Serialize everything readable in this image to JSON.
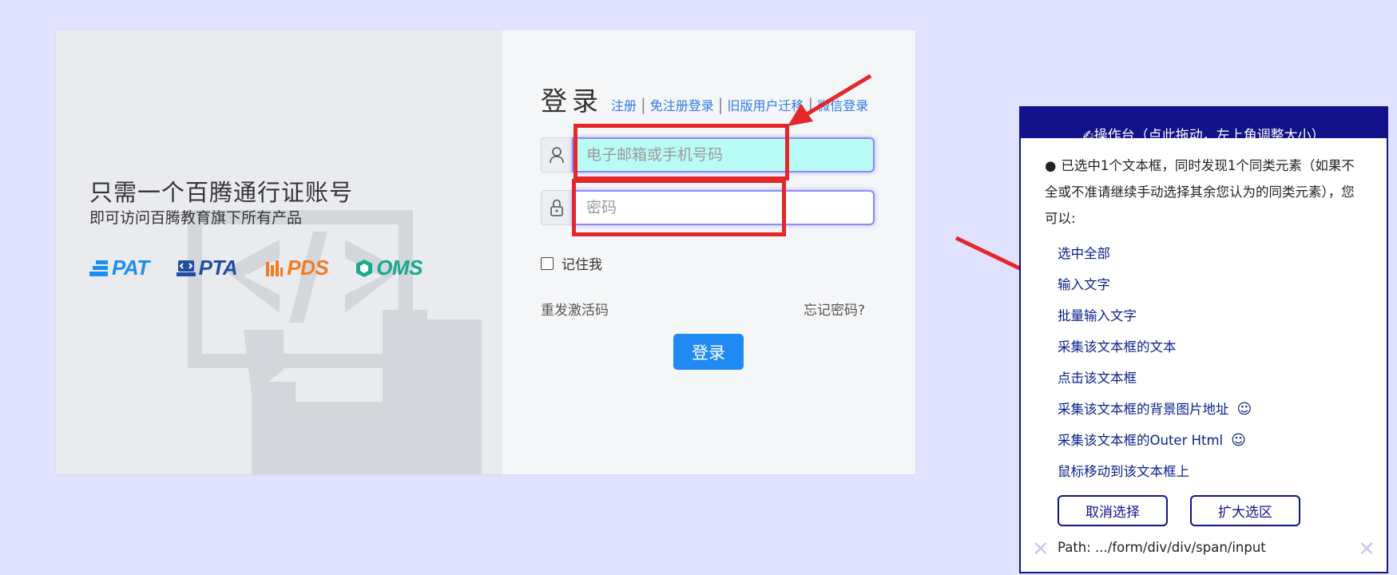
{
  "left": {
    "slogan_main": "只需一个百腾通行证账号",
    "slogan_sub": "即可访问百腾教育旗下所有产品",
    "brands": [
      {
        "label": "PAT",
        "color": "#1b8ef0",
        "icon": "pat-icon"
      },
      {
        "label": "PTA",
        "color": "#1f4fa3",
        "icon": "pta-icon"
      },
      {
        "label": "PDS",
        "color": "#f47a20",
        "icon": "pds-icon"
      },
      {
        "label": "OMS",
        "color": "#17a98f",
        "icon": "oms-icon"
      }
    ]
  },
  "login": {
    "title": "登录",
    "links": [
      "注册",
      "免注册登录",
      "旧版用户迁移",
      "微信登录"
    ],
    "username_placeholder": "电子邮箱或手机号码",
    "password_placeholder": "密码",
    "remember_label": "记住我",
    "resend_label": "重发激活码",
    "forgot_label": "忘记密码?",
    "submit_label": "登录"
  },
  "panel": {
    "header": "✍操作台（点此拖动，左上角调整大小）",
    "bullet": "●",
    "message": "已选中1个文本框，同时发现1个同类元素（如果不全或不准请继续手动选择其余您认为的同类元素），您可以:",
    "options": [
      "选中全部",
      "输入文字",
      "批量输入文字",
      "采集该文本框的文本",
      "点击该文本框",
      "采集该文本框的背景图片地址",
      "采集该文本框的Outer Html",
      "鼠标移动到该文本框上"
    ],
    "smile_glyph": "☺",
    "cancel_label": "取消选择",
    "expand_label": "扩大选区",
    "path": "Path: .../form/div/div/span/input",
    "close_glyph": "✕"
  },
  "colors": {
    "accent": "#1f8af3",
    "panel_navy": "#12128a",
    "annotation_red": "#e5262b",
    "highlight_cyan": "#b9fbf6"
  }
}
